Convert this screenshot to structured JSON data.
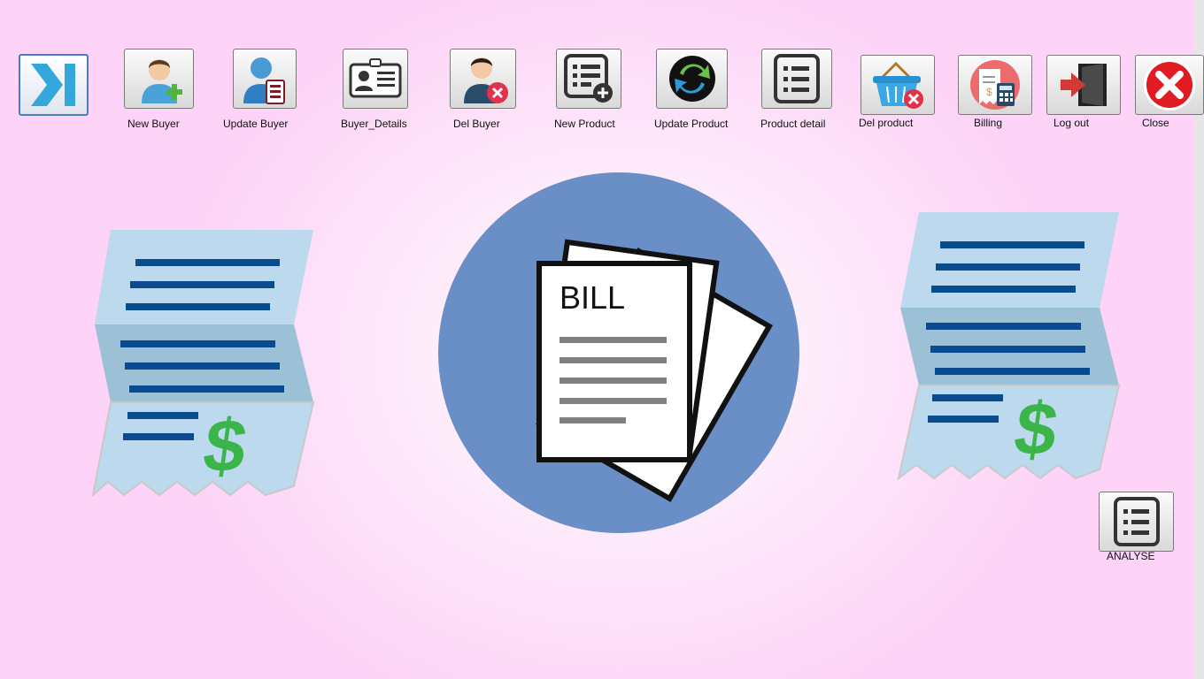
{
  "toolbar": {
    "toggle_icon": "collapse-right-icon",
    "buttons": [
      {
        "label": "New Buyer",
        "icon": "add-user-icon"
      },
      {
        "label": "Update Buyer",
        "icon": "edit-user-icon"
      },
      {
        "label": "Buyer_Details",
        "icon": "id-card-icon"
      },
      {
        "label": "Del Buyer",
        "icon": "delete-user-icon"
      },
      {
        "label": "New Product",
        "icon": "add-list-icon"
      },
      {
        "label": "Update Product",
        "icon": "refresh-icon"
      },
      {
        "label": "Product detail",
        "icon": "list-icon"
      },
      {
        "label": "Del product",
        "icon": "delete-basket-icon"
      },
      {
        "label": "Billing",
        "icon": "billing-calculator-icon"
      },
      {
        "label": "Log out",
        "icon": "exit-door-icon"
      },
      {
        "label": "Close",
        "icon": "close-icon"
      }
    ]
  },
  "main": {
    "bill_text": "BILL",
    "analyse_label": "ANALYSE",
    "analyse_icon": "list-icon"
  },
  "colors": {
    "background": "#fdd3f7",
    "circle": "#6a8fc7",
    "receipt_light": "#bcd9ed",
    "receipt_dark": "#9cc1d6",
    "receipt_lines": "#0a4b8f",
    "dollar": "#3bb54a"
  }
}
